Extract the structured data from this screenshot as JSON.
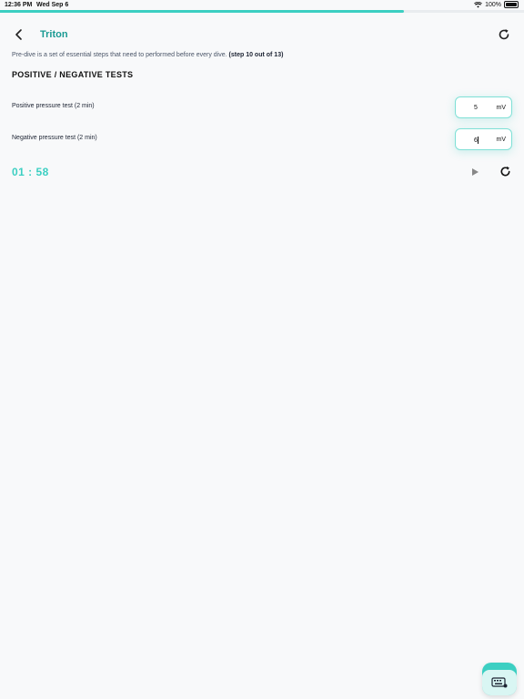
{
  "status_bar": {
    "time": "12:36 PM",
    "date": "Wed Sep 6",
    "battery": "100%",
    "icons": [
      "wifi-icon",
      "battery-icon"
    ]
  },
  "progress": {
    "fraction": 0.77
  },
  "header": {
    "title": "Triton",
    "back_icon": "chevron-left-icon",
    "refresh_icon": "refresh-icon"
  },
  "intro": {
    "text": "Pre-dive is a set of essential steps that need to performed before every dive.",
    "step": "(step 10 out of 13)"
  },
  "section": {
    "title": "POSITIVE / NEGATIVE TESTS"
  },
  "tests": [
    {
      "label": "Positive pressure test (2 min)",
      "value": "5",
      "unit": "mV"
    },
    {
      "label": "Negative pressure test (2 min)",
      "value": "6",
      "unit": "mV"
    }
  ],
  "timer": {
    "display": "01 : 58",
    "play_icon": "play-icon",
    "reset_icon": "refresh-icon"
  },
  "colors": {
    "accent": "#3ccfc2",
    "title": "#1a9a93",
    "background": "#f8f9fa"
  },
  "keyboard_button": {
    "icon": "keyboard-icon"
  }
}
